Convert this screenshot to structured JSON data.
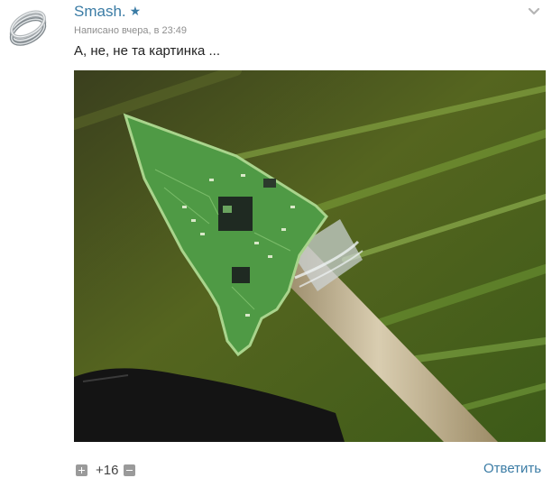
{
  "post": {
    "author": "Smash.",
    "star": "★",
    "meta": "Написано вчера, в 23:49",
    "text": "А, не, не та картинка ...",
    "image_icon": "circuit-board-arrowhead-photo"
  },
  "footer": {
    "score": "+16",
    "reply_label": "Ответить"
  },
  "colors": {
    "link": "#3b7ca5",
    "vote_button": "#9a9a9a"
  }
}
